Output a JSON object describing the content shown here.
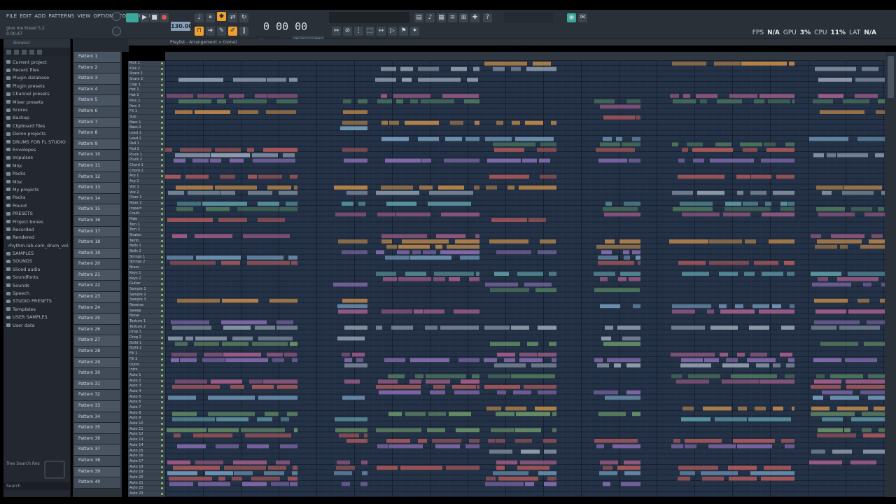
{
  "menu": [
    "FILE",
    "EDIT",
    "ADD",
    "PATTERNS",
    "VIEW",
    "OPTIONS",
    "TOOLS",
    "HELP"
  ],
  "hint_lines": [
    "give me bread 5.2",
    "0.00.47"
  ],
  "tempo": "130.000",
  "time_display": "0 00 00",
  "perf": {
    "fps_label": "FPS",
    "fps_value": "N/A",
    "gpu_label": "GPU",
    "gpu_value": "3%",
    "cpu_label": "CPU",
    "cpu_value": "11%",
    "lat_label": "LAT",
    "lat_value": "N/A"
  },
  "snap_mode": "Pattern 41",
  "line_mode": "Line",
  "playlist_title": "Playlist - Arrangement > (none)",
  "browser": {
    "header": "Browser",
    "items": [
      "Current project",
      "Recent files",
      "Plugin database",
      "Plugin presets",
      "Channel presets",
      "Mixer presets",
      "Scores",
      "Backup",
      "Clipboard files",
      "Demo projects",
      "DRUMS FOR FL STUDIO",
      "Envelopes",
      "Impulses",
      "Misc",
      "Packs",
      "Misc",
      "My projects",
      "Packs",
      "Pound",
      "PRESETS",
      "Project bones",
      "Recorded",
      "Rendered",
      "rhythm-lab.com_drum_vol.1",
      "SAMPLES",
      "SOUNDS",
      "Sliced audio",
      "Soundfonts",
      "Sounds",
      "Speech",
      "STUDIO PRESETS",
      "Templates",
      "USER SAMPLES",
      "User data"
    ],
    "footer": "Tree   Search Res",
    "search": "Search"
  },
  "patterns": [
    "Pattern 1",
    "Pattern 2",
    "Pattern 3",
    "Pattern 4",
    "Pattern 5",
    "Pattern 6",
    "Pattern 7",
    "Pattern 8",
    "Pattern 9",
    "Pattern 10",
    "Pattern 11",
    "Pattern 12",
    "Pattern 13",
    "Pattern 14",
    "Pattern 15",
    "Pattern 16",
    "Pattern 17",
    "Pattern 18",
    "Pattern 19",
    "Pattern 20",
    "Pattern 21",
    "Pattern 22",
    "Pattern 23",
    "Pattern 24",
    "Pattern 25",
    "Pattern 26",
    "Pattern 27",
    "Pattern 28",
    "Pattern 29",
    "Pattern 30",
    "Pattern 31",
    "Pattern 32",
    "Pattern 33",
    "Pattern 34",
    "Pattern 35",
    "Pattern 36",
    "Pattern 37",
    "Pattern 38",
    "Pattern 39",
    "Pattern 40"
  ],
  "tracks": [
    "Kick 1",
    "Kick 2",
    "Snare 1",
    "Snare 2",
    "Clap 1",
    "Hat 1",
    "Hat 2",
    "Perc 1",
    "Perc 2",
    "FX 1",
    "Sub",
    "Bass 1",
    "Bass 2",
    "Lead 1",
    "Lead 2",
    "Pad 1",
    "Pad 2",
    "Pluck 1",
    "Pluck 2",
    "Chord 1",
    "Chord 2",
    "Arp 1",
    "Arp 2",
    "Vox 1",
    "Vox 2",
    "Riser 1",
    "Riser 2",
    "Impact",
    "Crash",
    "Ride",
    "Tom 1",
    "Tom 2",
    "Shaker",
    "Tamb",
    "Bells 1",
    "Bells 2",
    "Strings 1",
    "Strings 2",
    "Brass",
    "Keys 1",
    "Keys 2",
    "Guitar",
    "Sample 1",
    "Sample 2",
    "Sample 3",
    "Reverse",
    "Sweep",
    "Noise",
    "Texture 1",
    "Texture 2",
    "Drop 1",
    "Drop 2",
    "Build 1",
    "Build 2",
    "Fill 1",
    "Fill 2",
    "Outro",
    "Intro",
    "Auto 1",
    "Auto 2",
    "Auto 3",
    "Auto 4",
    "Auto 5",
    "Auto 6",
    "Auto 7",
    "Auto 8",
    "Auto 9",
    "Auto 10",
    "Auto 11",
    "Auto 12",
    "Auto 13",
    "Auto 14",
    "Auto 15",
    "Auto 16",
    "Auto 17",
    "Auto 18",
    "Auto 19",
    "Auto 20",
    "Auto 21",
    "Auto 22",
    "Auto 23"
  ],
  "colors": {
    "accent": "#f0a030",
    "grid_bg": "#243247",
    "clip_palette": [
      "#7aa3c4",
      "#6d9a6a",
      "#b55b5b",
      "#8c6fb5",
      "#5f9fa8",
      "#c48b4a",
      "#9aa7b5",
      "#a85f8c",
      "#4f7b5d"
    ]
  }
}
